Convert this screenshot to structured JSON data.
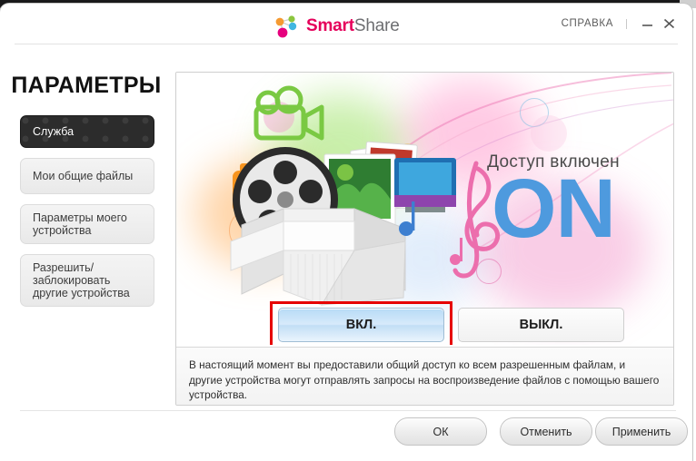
{
  "window": {
    "logo": {
      "icon": "smartshare-logo-icon",
      "text_primary": "Smart",
      "text_secondary": "Share"
    },
    "help_label": "СПРАВКА",
    "minimize_icon": "minimize-icon",
    "close_icon": "close-icon"
  },
  "sidebar": {
    "title": "ПАРАМЕТРЫ",
    "items": [
      {
        "label": "Служба",
        "active": true
      },
      {
        "label": "Мои общие файлы",
        "active": false
      },
      {
        "label": "Параметры моего устройства",
        "active": false
      },
      {
        "label": "Разрешить/заблокировать другие устройства",
        "active": false
      }
    ]
  },
  "main": {
    "status_label": "Доступ включен",
    "status_value": "ON",
    "status_color": "#4e9ade",
    "highlight_color": "#e60000",
    "toggle_on_label": "ВКЛ.",
    "toggle_off_label": "ВЫКЛ.",
    "toggle_on_selected": true,
    "description": "В настоящий момент вы предоставили общий доступ ко всем разрешенным файлам, и другие устройства могут отправлять запросы на воспроизведение файлов с помощью вашего устройства.",
    "illustration_icons": [
      "open-box-icon",
      "film-reel-icon",
      "photo-stack-icon",
      "monitor-icon",
      "camera-icon",
      "video-camera-icon",
      "treble-clef-icon",
      "music-note-icon"
    ]
  },
  "footer": {
    "ok_label": "ОК",
    "cancel_label": "Отменить",
    "apply_label": "Применить"
  }
}
